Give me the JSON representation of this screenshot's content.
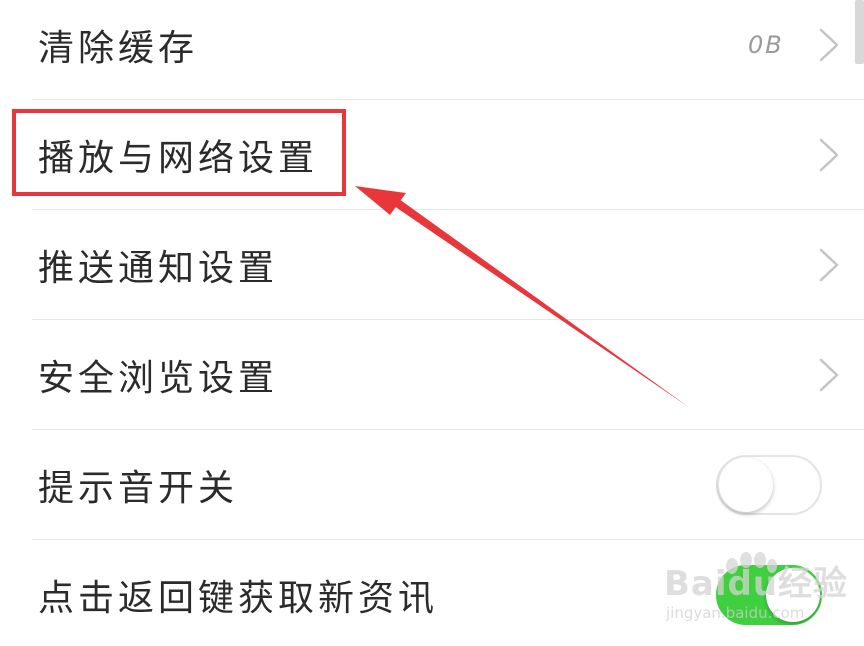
{
  "settings": {
    "items": [
      {
        "label": "清除缓存",
        "value": "0B",
        "control": "chevron"
      },
      {
        "label": "播放与网络设置",
        "control": "chevron"
      },
      {
        "label": "推送通知设置",
        "control": "chevron"
      },
      {
        "label": "安全浏览设置",
        "control": "chevron"
      },
      {
        "label": "提示音开关",
        "control": "toggle",
        "state": "off"
      },
      {
        "label": "点击返回键获取新资讯",
        "control": "toggle",
        "state": "on"
      }
    ]
  },
  "annotation": {
    "highlight_color": "#e8373b",
    "highlighted_item": "播放与网络设置"
  },
  "colors": {
    "toggle_on": "#3fcf3f",
    "divider": "#e6e6e6",
    "text": "#2b2b2b"
  },
  "icons": {
    "row_arrow": "chevron-right-icon",
    "annotation": "red-arrow-icon"
  },
  "watermark": {
    "brand": "Baidu经验",
    "url": "jingyan.baidu.com"
  }
}
